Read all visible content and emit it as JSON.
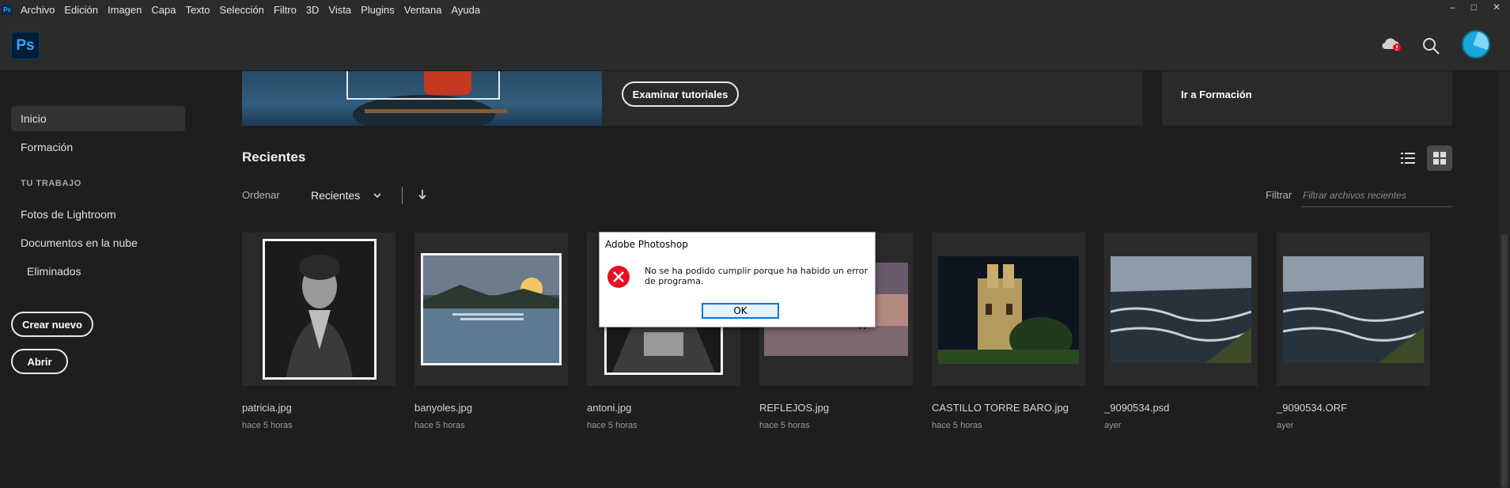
{
  "app": {
    "icon": "ps-icon",
    "logo_text": "Ps"
  },
  "menu": [
    "Archivo",
    "Edición",
    "Imagen",
    "Capa",
    "Texto",
    "Selección",
    "Filtro",
    "3D",
    "Vista",
    "Plugins",
    "Ventana",
    "Ayuda"
  ],
  "window_controls": {
    "minimize": "–",
    "maximize": "□",
    "close": "✕"
  },
  "header": {
    "icons": [
      "cloud-sync-icon",
      "search-icon",
      "avatar"
    ]
  },
  "sidebar": {
    "items": [
      {
        "label": "Inicio",
        "active": true
      },
      {
        "label": "Formación",
        "active": false
      }
    ],
    "section_title": "TU TRABAJO",
    "work_items": [
      "Fotos de Lightroom",
      "Documentos en la nube",
      "Eliminados"
    ],
    "create_button": "Crear nuevo",
    "open_button": "Abrir"
  },
  "banner": {
    "tutorials_button": "Examinar tutoriales",
    "learn_link": "Ir a Formación"
  },
  "recents": {
    "title": "Recientes",
    "sort_label": "Ordenar",
    "sort_value": "Recientes",
    "filter_label": "Filtrar",
    "filter_placeholder": "Filtrar archivos recientes",
    "files": [
      {
        "name": "patricia.jpg",
        "time": "hace 5 horas"
      },
      {
        "name": "banyoles.jpg",
        "time": "hace 5 horas"
      },
      {
        "name": "antoni.jpg",
        "time": "hace 5 horas"
      },
      {
        "name": "REFLEJOS.jpg",
        "time": "hace 5 horas"
      },
      {
        "name": "CASTILLO TORRE BARO.jpg",
        "time": "hace 5 horas"
      },
      {
        "name": "_9090534.psd",
        "time": "ayer"
      },
      {
        "name": "_9090534.ORF",
        "time": "ayer"
      }
    ]
  },
  "dialog": {
    "title": "Adobe Photoshop",
    "message": "No se ha podido cumplir porque ha habido un error de programa.",
    "ok_button": "OK",
    "icon": "error-icon"
  },
  "colors": {
    "accent": "#31a8ff",
    "background": "#1e1e1e",
    "panel": "#2b2b2b",
    "error": "#e81123"
  }
}
